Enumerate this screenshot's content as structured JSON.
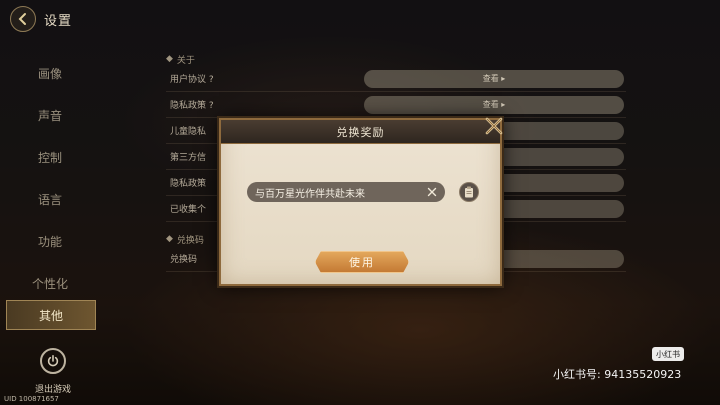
{
  "header": {
    "title": "设置"
  },
  "sidebar": {
    "items": [
      {
        "label": "画像"
      },
      {
        "label": "声音"
      },
      {
        "label": "控制"
      },
      {
        "label": "语言"
      },
      {
        "label": "功能"
      },
      {
        "label": "个性化"
      },
      {
        "label": "其他"
      }
    ],
    "exit_label": "退出游戏"
  },
  "uid": "UID 100871657",
  "settings": {
    "about_header": "关于",
    "about_rows": [
      {
        "label": "用户协议 ?",
        "button": "查看 ▸"
      },
      {
        "label": "隐私政策 ?",
        "button": "查看 ▸"
      },
      {
        "label": "儿童隐私",
        "button": ""
      },
      {
        "label": "第三方信",
        "button": ""
      },
      {
        "label": "隐私政策",
        "button": ""
      },
      {
        "label": "已收集个",
        "button": ""
      }
    ],
    "redeem_header": "兑换码",
    "redeem_rows": [
      {
        "label": "兑换码",
        "button": ""
      }
    ]
  },
  "dialog": {
    "title": "兑换奖励",
    "input_value": "与百万星光作伴共赴未来",
    "use_button": "使用"
  },
  "watermark": {
    "badge": "小红书",
    "text": "小红书号: 94135520923"
  },
  "colors": {
    "accent_orange": "#d48f45",
    "dialog_bg": "#ebe1cf",
    "header_dark": "#3a3028"
  }
}
